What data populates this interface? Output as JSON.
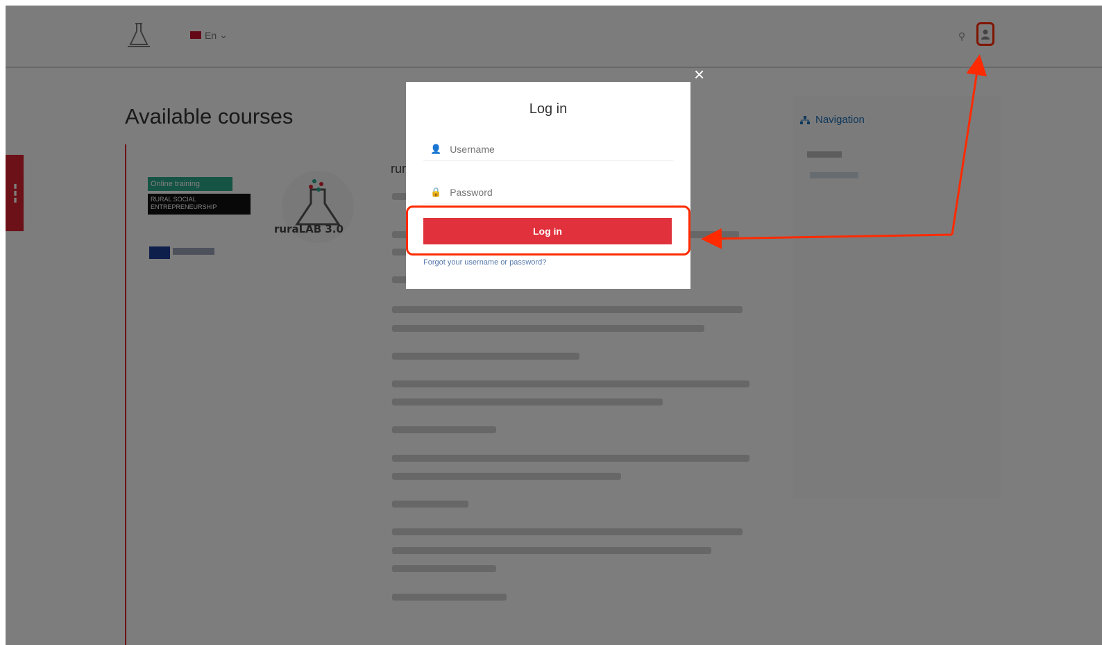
{
  "header": {
    "language": "En"
  },
  "page": {
    "title": "Available courses"
  },
  "course": {
    "badge_green": "Online training",
    "badge_black": "RURAL SOCIAL ENTREPRENEURSHIP",
    "logo_text": "ruraLAB 3.0",
    "name_fragment": "rur"
  },
  "sidebar": {
    "title": "Navigation"
  },
  "modal": {
    "title": "Log in",
    "username_placeholder": "Username",
    "password_placeholder": "Password",
    "login_button": "Log in",
    "forgot_link": "Forgot your username or password?",
    "close": "×"
  },
  "colors": {
    "accent_red": "#e0313c",
    "annotation": "#ff2a00",
    "nav_blue": "#1a6fb6"
  }
}
